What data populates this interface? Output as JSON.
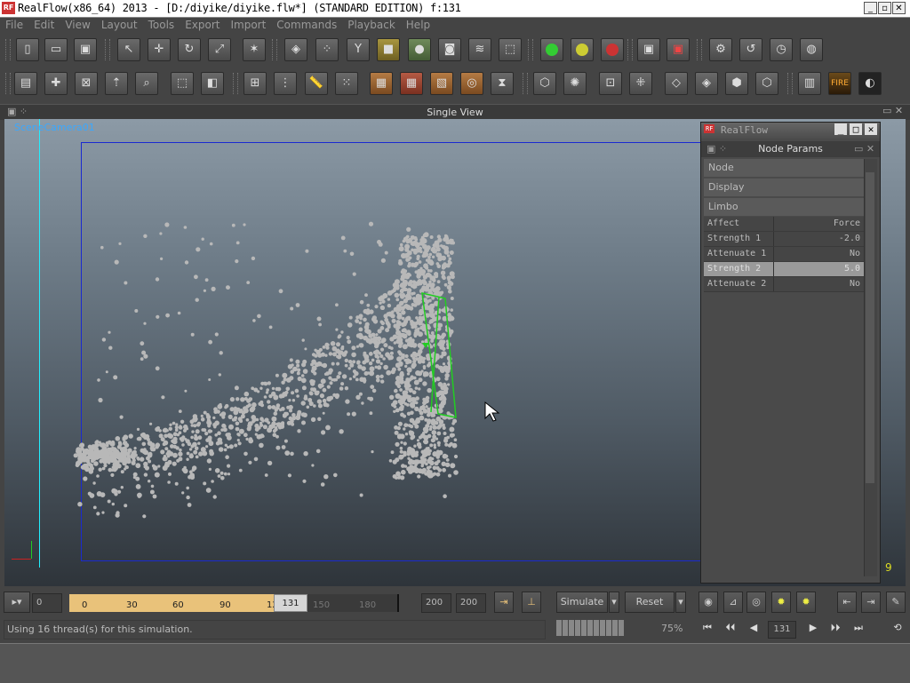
{
  "window": {
    "title": "RealFlow(x86_64) 2013 - [D:/diyike/diyike.flw*] (STANDARD EDITION) f:131",
    "logo": "RF",
    "minimize": "_",
    "restore": "▫",
    "close": "✕"
  },
  "menu": [
    "File",
    "Edit",
    "View",
    "Layout",
    "Tools",
    "Export",
    "Import",
    "Commands",
    "Playback",
    "Help"
  ],
  "viewport": {
    "title": "Single View",
    "camera_label": "SceneCamera01",
    "frame_number": "9"
  },
  "panel": {
    "window_title": "RealFlow",
    "header": "Node Params",
    "sections": [
      "Node",
      "Display",
      "Limbo"
    ],
    "params": [
      {
        "label": "Affect",
        "value": "Force",
        "selected": false
      },
      {
        "label": "Strength 1",
        "value": "-2.0",
        "selected": false
      },
      {
        "label": "Attenuate 1",
        "value": "No",
        "selected": false
      },
      {
        "label": "Strength 2",
        "value": "5.0",
        "selected": true
      },
      {
        "label": "Attenuate 2",
        "value": "No",
        "selected": false
      }
    ]
  },
  "timeline": {
    "start_field": "0",
    "ticks": [
      "0",
      "30",
      "60",
      "90",
      "12",
      "150",
      "180"
    ],
    "current": "131",
    "end_field_1": "200",
    "end_field_2": "200",
    "simulate_label": "Simulate",
    "reset_label": "Reset"
  },
  "status": {
    "message": "Using 16 thread(s) for this simulation.",
    "progress_percent": "75%",
    "current_frame": "131"
  },
  "colors": {
    "accent_gold": "#e9c27a",
    "camera_frame": "#1a2ad0",
    "camera_label": "#3aa8ff",
    "frame_number": "#dddd22"
  }
}
